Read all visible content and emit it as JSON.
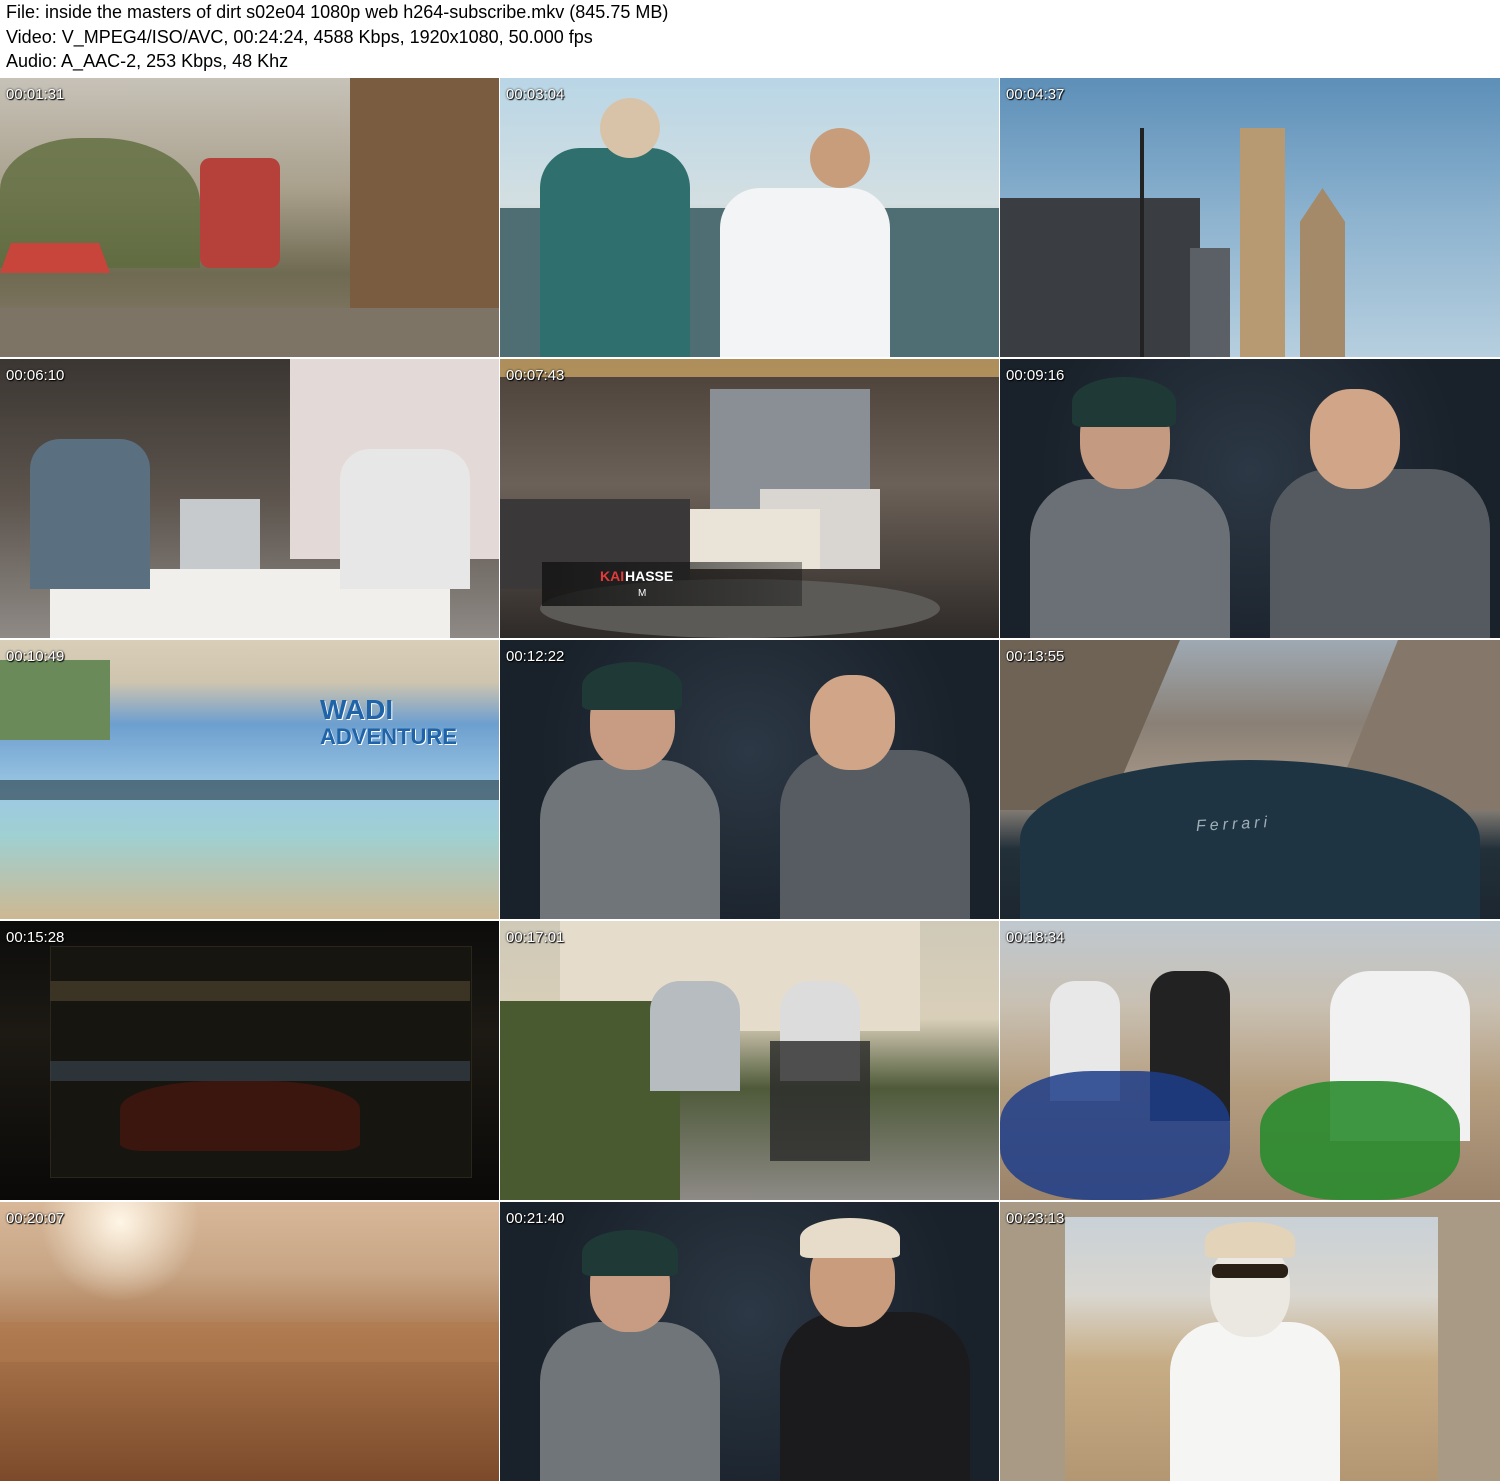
{
  "header": {
    "file_line": "File: inside the masters of dirt s02e04 1080p web h264-subscribe.mkv (845.75 MB)",
    "video_line": "Video: V_MPEG4/ISO/AVC, 00:24:24, 4588 Kbps, 1920x1080, 50.000 fps",
    "audio_line": "Audio: A_AAC-2, 253 Kbps, 48 Khz"
  },
  "thumbnails": [
    {
      "timestamp": "00:01:31"
    },
    {
      "timestamp": "00:03:04"
    },
    {
      "timestamp": "00:04:37"
    },
    {
      "timestamp": "00:06:10"
    },
    {
      "timestamp": "00:07:43",
      "overlay": {
        "name_first": "KAI",
        "name_last": "HASSE",
        "role": "M"
      }
    },
    {
      "timestamp": "00:09:16"
    },
    {
      "timestamp": "00:10:49",
      "sign": {
        "line1": "WADI",
        "line2": "ADVENTURE"
      }
    },
    {
      "timestamp": "00:12:22"
    },
    {
      "timestamp": "00:13:55",
      "badge": "Ferrari"
    },
    {
      "timestamp": "00:15:28"
    },
    {
      "timestamp": "00:17:01"
    },
    {
      "timestamp": "00:18:34"
    },
    {
      "timestamp": "00:20:07"
    },
    {
      "timestamp": "00:21:40"
    },
    {
      "timestamp": "00:23:13"
    }
  ]
}
